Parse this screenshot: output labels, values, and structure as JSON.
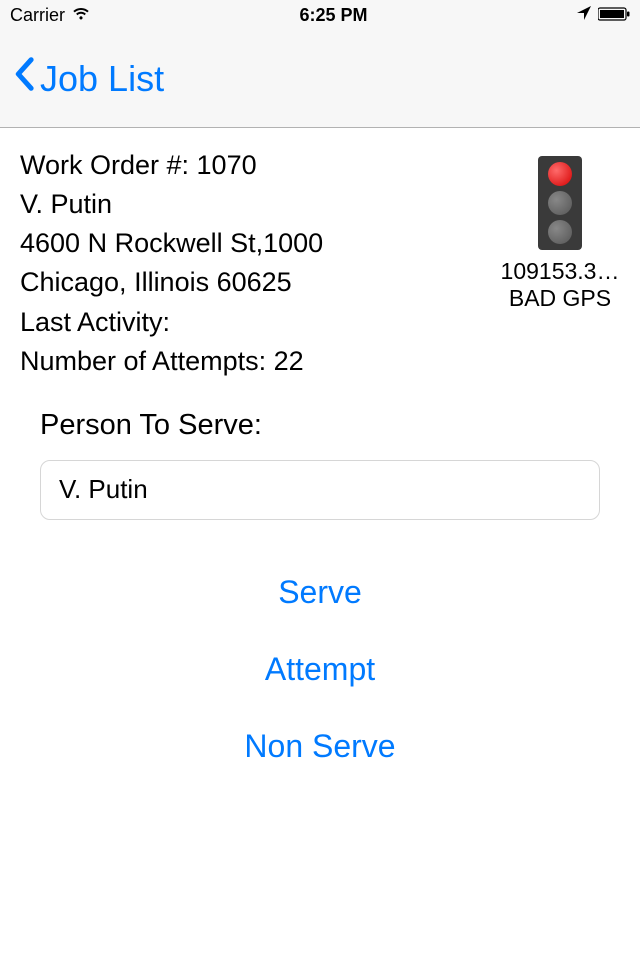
{
  "status_bar": {
    "carrier": "Carrier",
    "time": "6:25 PM"
  },
  "nav": {
    "back_label": "Job List"
  },
  "details": {
    "work_order_line": "Work Order #: 1070",
    "name": "V. Putin",
    "address_line1": "4600 N Rockwell St,1000",
    "address_line2": "Chicago, Illinois 60625",
    "last_activity_line": "Last Activity:",
    "attempts_line": "Number of Attempts: 22"
  },
  "gps": {
    "value": "109153.3…",
    "status": "BAD GPS"
  },
  "form": {
    "label": "Person To Serve:",
    "person_value": "V. Putin"
  },
  "actions": {
    "serve": "Serve",
    "attempt": "Attempt",
    "non_serve": "Non Serve"
  }
}
